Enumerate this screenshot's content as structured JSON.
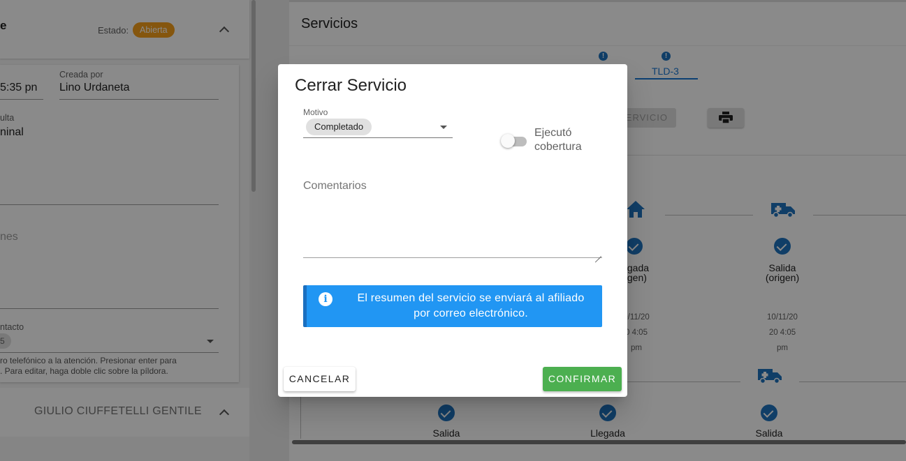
{
  "left_panel": {
    "section_title_fragment": "e",
    "estado_label": "Estado:",
    "estado_value": "Abierta",
    "field_time_fragment": "5:35 pn",
    "creada_por_label": "Creada por",
    "creada_por_value": "Lino Urdaneta",
    "consulta_label_fragment": "ulta",
    "consulta_value_fragment": "ninal",
    "observaciones_fragment": "nes",
    "contacto_label_fragment": "ntacto",
    "contacto_pill_fragment": "5",
    "helper_line1": "ro telefónico a la atención. Presionar enter para",
    "helper_line2": ". Para editar, haga doble clic sobre la píldora.",
    "person_name": "GIULIO CIUFFETELLI GENTILE"
  },
  "right_panel": {
    "title": "Servicios",
    "tab_alert_glyph": "!",
    "active_tab": "TLD-3",
    "servicio_button_fragment": "ERVICIO",
    "steps_row1": [
      {
        "label_l1": "legada",
        "label_l2": "rigen)",
        "date_l1": "0/11/20",
        "date_l2": "0 4:05",
        "date_l3": "pm"
      },
      {
        "label_l1": "Salida",
        "label_l2": "(origen)",
        "date_l1": "10/11/20",
        "date_l2": "20 4:05",
        "date_l3": "pm"
      }
    ],
    "steps_row2": [
      "Salida",
      "Llegada",
      "Salida"
    ]
  },
  "dialog": {
    "title": "Cerrar Servicio",
    "motivo_label": "Motivo",
    "motivo_value": "Completado",
    "switch_label": "Ejecutó cobertura",
    "switch_on": false,
    "comentarios_label": "Comentarios",
    "comentarios_value": "",
    "info_glyph": "i",
    "info_text": "El resumen del servicio se enviará al afiliado por correo electrónico.",
    "cancel_label": "CANCELAR",
    "confirm_label": "CONFIRMAR"
  },
  "colors": {
    "badge": "#f59f1b",
    "primary": "#1e73be",
    "info": "#2196f3",
    "confirm": "#4caf50"
  }
}
